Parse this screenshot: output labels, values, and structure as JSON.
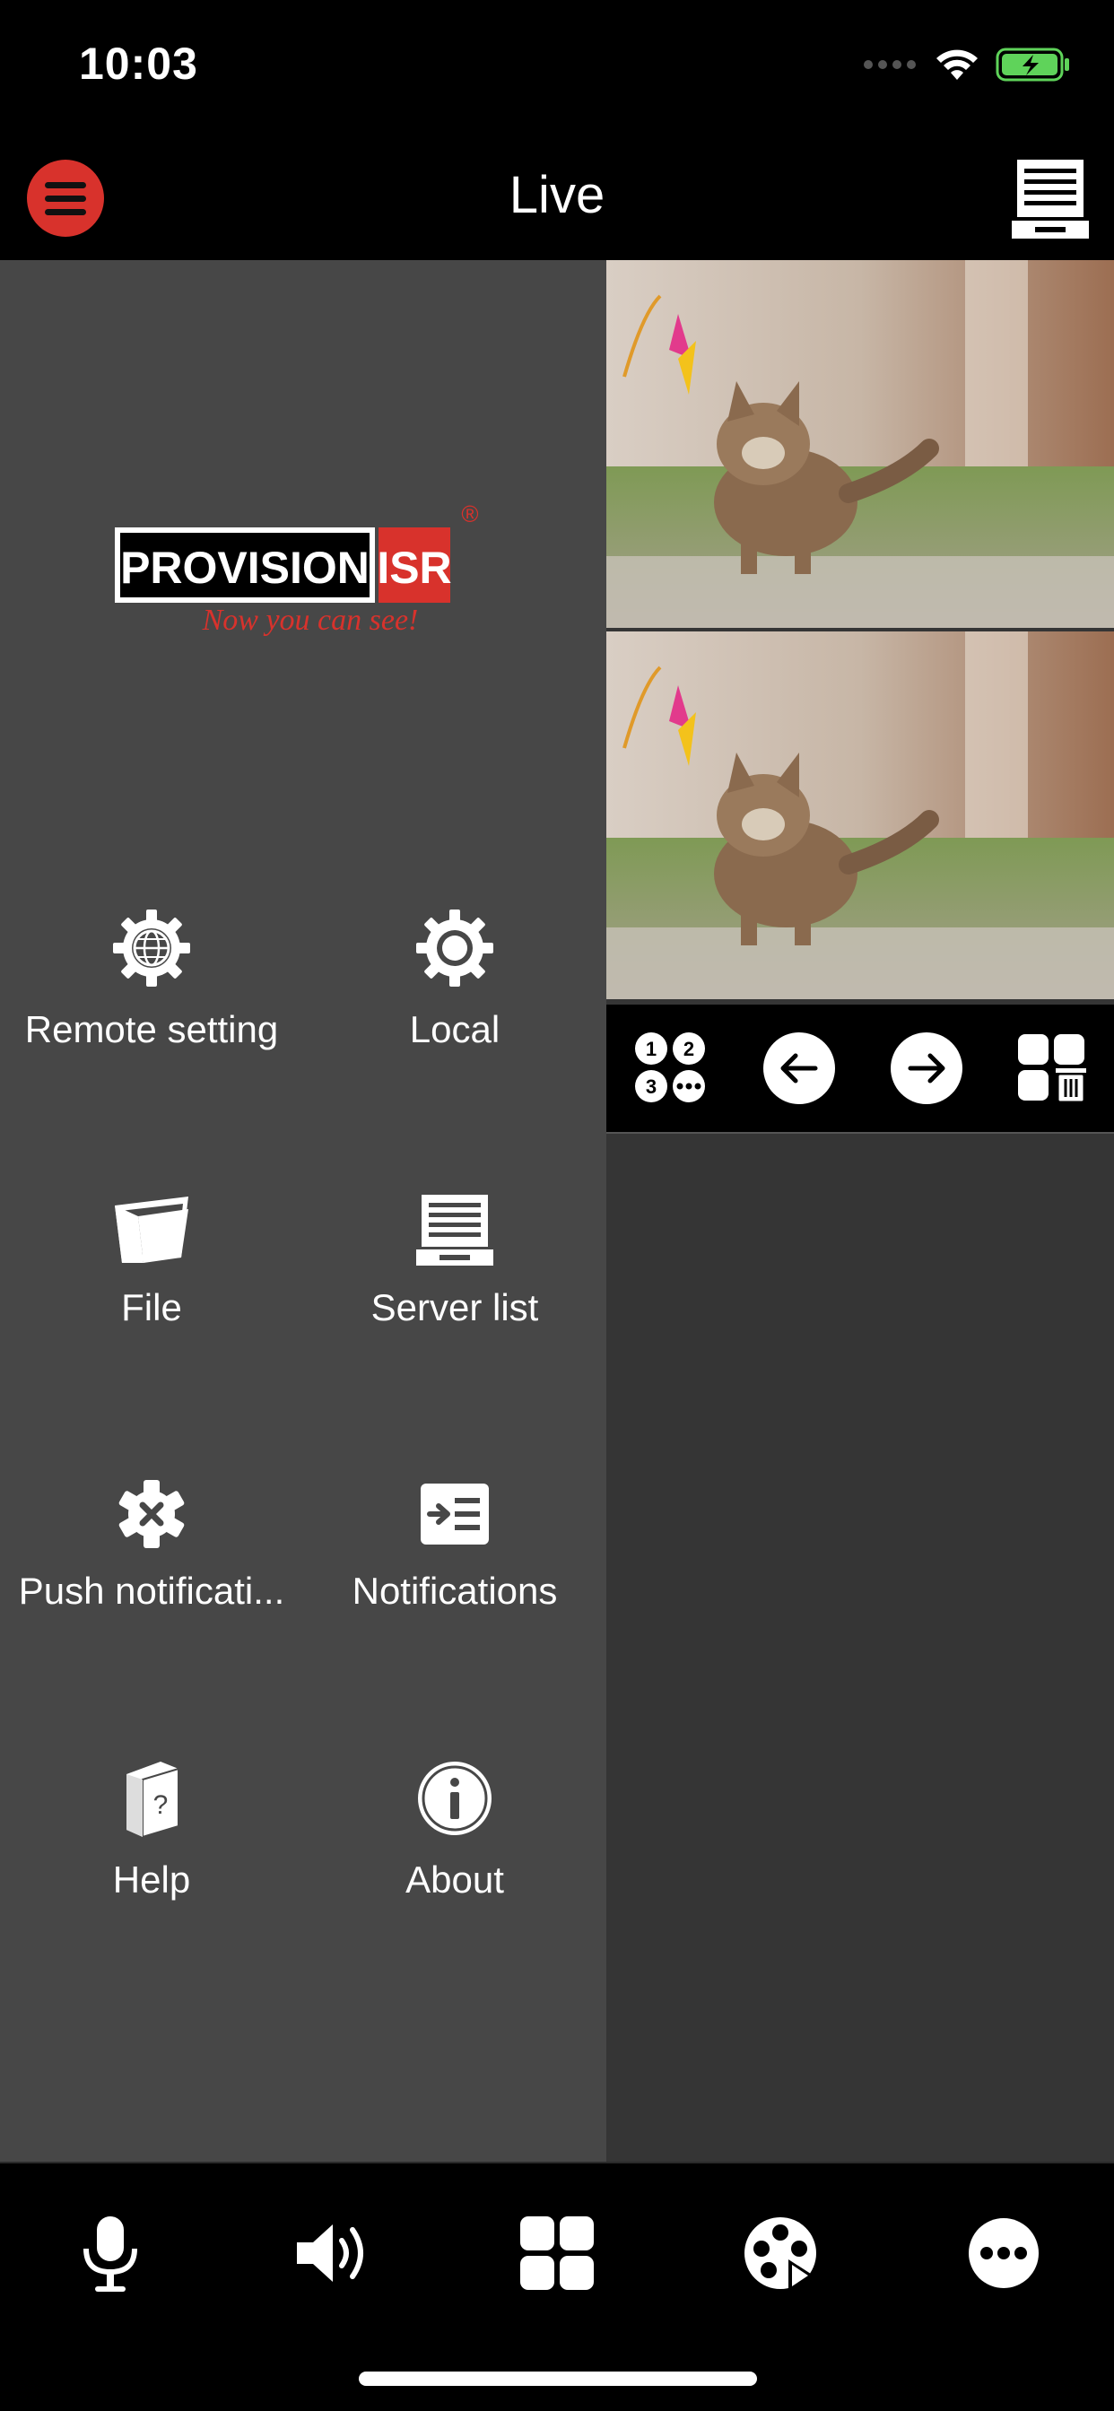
{
  "status_bar": {
    "time": "10:03"
  },
  "nav": {
    "title": "Live",
    "menu_icon": "hamburger-icon",
    "right_icon": "server-list-icon"
  },
  "brand": {
    "logo_text_left": "PROVISION",
    "logo_text_right": "ISR",
    "logo_tagline": "Now you can see!",
    "logo_mark": "®",
    "accent": "#d8322c"
  },
  "menu": {
    "items": [
      {
        "label": "Remote setting",
        "icon": "globe-gear-icon"
      },
      {
        "label": "Local",
        "icon": "gear-icon"
      },
      {
        "label": "File",
        "icon": "folder-icon"
      },
      {
        "label": "Server list",
        "icon": "server-list-icon"
      },
      {
        "label": "Push notificati...",
        "icon": "push-gear-icon"
      },
      {
        "label": "Notifications",
        "icon": "notifications-icon"
      },
      {
        "label": "Help",
        "icon": "help-book-icon"
      },
      {
        "label": "About",
        "icon": "info-icon"
      }
    ]
  },
  "controls": {
    "layout_numbers": [
      "1",
      "2",
      "3"
    ],
    "buttons": [
      "layout-select-icon",
      "previous-arrow-icon",
      "next-arrow-icon",
      "delete-layout-icon"
    ]
  },
  "tabs": [
    "microphone-icon",
    "speaker-icon",
    "grid-icon",
    "record-film-icon",
    "more-icon"
  ]
}
